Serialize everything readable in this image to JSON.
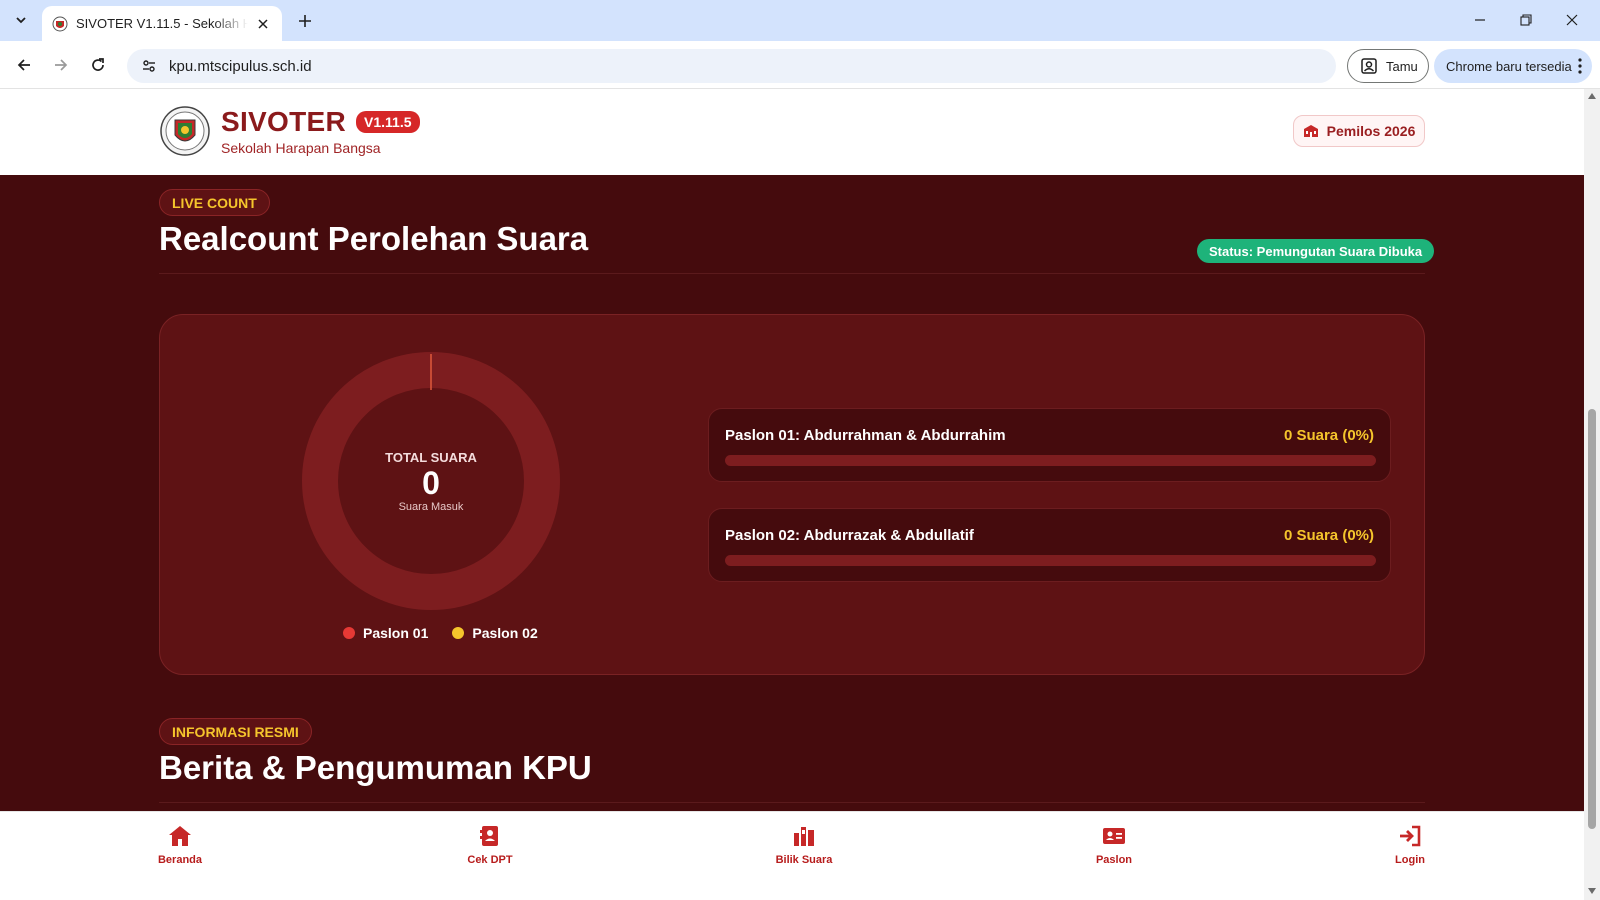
{
  "browser": {
    "tab_title": "SIVOTER V1.11.5 - Sekolah Harapan Bangsa",
    "url": "kpu.mtscipulus.sch.id",
    "profile_label": "Tamu",
    "update_label": "Chrome baru tersedia"
  },
  "header": {
    "app_name": "SIVOTER",
    "version": "V1.11.5",
    "school": "Sekolah Harapan Bangsa",
    "event_label": "Pemilos 2026"
  },
  "realcount": {
    "pill": "LIVE COUNT",
    "title": "Realcount Perolehan Suara",
    "status": "Status: Pemungutan Suara Dibuka",
    "total_label": "TOTAL SUARA",
    "total_value": "0",
    "total_sub": "Suara Masuk",
    "legend": [
      {
        "label": "Paslon 01",
        "color": "#e53935"
      },
      {
        "label": "Paslon 02",
        "color": "#f5c52c"
      }
    ],
    "candidates": [
      {
        "name": "Paslon 01: Abdurrahman & Abdurrahim",
        "votes_label": "0 Suara (0%)",
        "percent": 0
      },
      {
        "name": "Paslon 02: Abdurrazak & Abdullatif",
        "votes_label": "0 Suara (0%)",
        "percent": 0
      }
    ]
  },
  "news": {
    "pill": "INFORMASI RESMI",
    "title": "Berita & Pengumuman KPU"
  },
  "bottom_nav": [
    {
      "label": "Beranda",
      "icon": "home-icon"
    },
    {
      "label": "Cek DPT",
      "icon": "id-card-icon"
    },
    {
      "label": "Bilik Suara",
      "icon": "booth-icon"
    },
    {
      "label": "Paslon",
      "icon": "candidates-icon"
    },
    {
      "label": "Login",
      "icon": "login-icon"
    }
  ],
  "colors": {
    "brand": "#8b1a1c",
    "page_bg": "#450b0d",
    "accent_yellow": "#f5c52c",
    "status_green": "#1eb37a"
  }
}
